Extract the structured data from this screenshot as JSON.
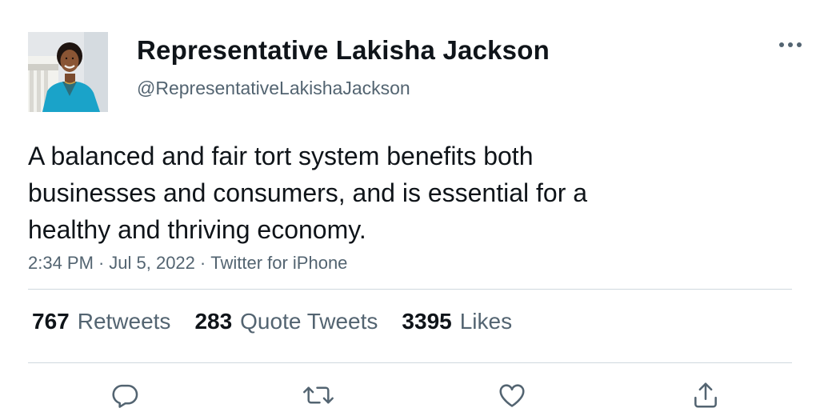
{
  "author": {
    "display_name": "Representative Lakisha Jackson",
    "handle": "@RepresentativeLakishaJackson",
    "avatar": "avatar-photo"
  },
  "tweet": {
    "lines": [
      "A balanced and fair tort system benefits both",
      "businesses and consumers, and is essential for a",
      "healthy and thriving economy."
    ],
    "time": "2:34 PM",
    "date": "Jul 5, 2022",
    "source": "Twitter for iPhone",
    "separator": "·"
  },
  "stats": {
    "retweets": {
      "count": "767",
      "label": "Retweets"
    },
    "quotes": {
      "count": "283",
      "label": "Quote Tweets"
    },
    "likes": {
      "count": "3395",
      "label": "Likes"
    }
  },
  "actions": {
    "reply": "reply-icon",
    "retweet": "retweet-icon",
    "like": "heart-icon",
    "share": "share-icon"
  },
  "colors": {
    "text": "#0f1419",
    "secondary": "#536471",
    "divider": "#cfd9de",
    "icon": "#536471",
    "avatar_blazer": "#1aa3c9"
  }
}
